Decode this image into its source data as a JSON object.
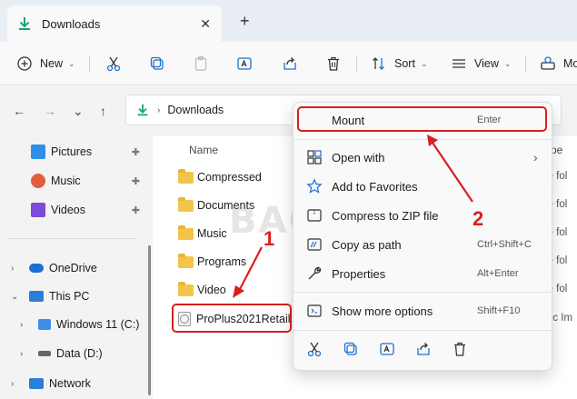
{
  "window": {
    "tab_title": "Downloads",
    "close_glyph": "✕",
    "new_tab_glyph": "+"
  },
  "toolbar": {
    "new_label": "New",
    "sort_label": "Sort",
    "view_label": "View",
    "more_label": "Mo",
    "caret": "⌄"
  },
  "address": {
    "path": "Downloads",
    "chevron": "›"
  },
  "nav": {
    "back": "←",
    "forward": "→",
    "recent": "⌄",
    "up": "↑"
  },
  "sidebar": {
    "quick": [
      {
        "label": "Pictures",
        "icon": "pictures-icon",
        "color": "#2f8fe8"
      },
      {
        "label": "Music",
        "icon": "music-icon",
        "color": "#e25d3c"
      },
      {
        "label": "Videos",
        "icon": "videos-icon",
        "color": "#7d4ad9"
      }
    ],
    "pin_glyph": "✚",
    "tree": [
      {
        "label": "OneDrive",
        "chevron": "›"
      },
      {
        "label": "This PC",
        "chevron": "⌄"
      },
      {
        "label": "Windows 11 (C:)",
        "chevron": "›"
      },
      {
        "label": "Data (D:)",
        "chevron": "›"
      },
      {
        "label": "Network",
        "chevron": "›"
      }
    ]
  },
  "files": {
    "header_name": "Name",
    "header_type": "ype",
    "items": [
      {
        "name": "Compressed",
        "type": "le fol"
      },
      {
        "name": "Documents",
        "type": "le fol"
      },
      {
        "name": "Music",
        "type": "le fol"
      },
      {
        "name": "Programs",
        "type": "le fol"
      },
      {
        "name": "Video",
        "type": "le fol"
      },
      {
        "name": "ProPlus2021Retail",
        "type": "isc Im"
      }
    ]
  },
  "context_menu": {
    "items": [
      {
        "label": "Mount",
        "shortcut": "Enter",
        "icon": "mount-icon"
      },
      {
        "label": "Open with",
        "shortcut": "",
        "icon": "open-with-icon",
        "submenu": "›"
      },
      {
        "label": "Add to Favorites",
        "shortcut": "",
        "icon": "star-icon"
      },
      {
        "label": "Compress to ZIP file",
        "shortcut": "",
        "icon": "zip-icon"
      },
      {
        "label": "Copy as path",
        "shortcut": "Ctrl+Shift+C",
        "icon": "copy-path-icon"
      },
      {
        "label": "Properties",
        "shortcut": "Alt+Enter",
        "icon": "wrench-icon"
      },
      {
        "label": "Show more options",
        "shortcut": "Shift+F10",
        "icon": "more-options-icon"
      }
    ]
  },
  "annotations": {
    "step1": "1",
    "step2": "2",
    "color": "#d82020"
  },
  "watermark": "BAGITEKNO"
}
